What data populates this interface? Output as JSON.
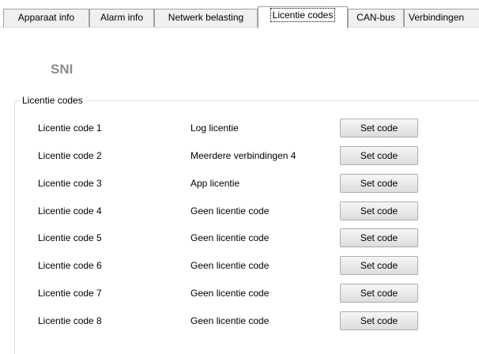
{
  "tabs": [
    {
      "label": "Apparaat info",
      "active": false
    },
    {
      "label": "Alarm info",
      "active": false
    },
    {
      "label": "Netwerk belasting",
      "active": false
    },
    {
      "label": "Licentie codes",
      "active": true
    },
    {
      "label": "CAN-bus",
      "active": false
    },
    {
      "label": "Verbindingen",
      "active": false
    }
  ],
  "company_label": "SNI",
  "group": {
    "title": "Licentie codes",
    "rows": [
      {
        "label": "Licentie code 1",
        "value": "Log licentie",
        "button": "Set code"
      },
      {
        "label": "Licentie code 2",
        "value": "Meerdere verbindingen 4",
        "button": "Set code"
      },
      {
        "label": "Licentie code 3",
        "value": "App licentie",
        "button": "Set code"
      },
      {
        "label": "Licentie code 4",
        "value": "Geen licentie code",
        "button": "Set code"
      },
      {
        "label": "Licentie code 5",
        "value": "Geen licentie code",
        "button": "Set code"
      },
      {
        "label": "Licentie code 6",
        "value": "Geen licentie code",
        "button": "Set code"
      },
      {
        "label": "Licentie code 7",
        "value": "Geen licentie code",
        "button": "Set code"
      },
      {
        "label": "Licentie code 8",
        "value": "Geen licentie code",
        "button": "Set code"
      }
    ]
  },
  "colors": {
    "company_label": "#8c8c8c",
    "tab_border": "#a0a0a0",
    "tab_background": "#f0f0f0",
    "groupbox_border": "#dcdcdc"
  }
}
